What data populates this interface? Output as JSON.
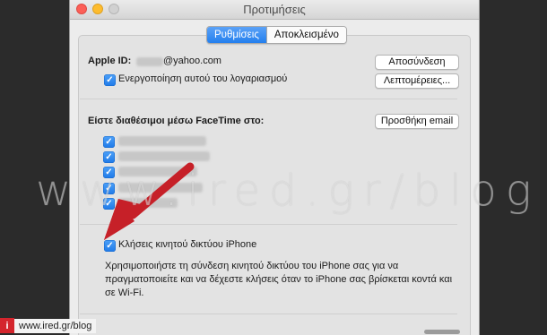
{
  "window": {
    "title": "Προτιμήσεις",
    "tabs": [
      {
        "label": "Ρυθμίσεις",
        "active": true
      },
      {
        "label": "Αποκλεισμένο",
        "active": false
      }
    ]
  },
  "account": {
    "apple_id_label": "Apple ID:",
    "email_suffix": "@yahoo.com",
    "enable_label": "Ενεργοποίηση αυτού του λογαριασμού",
    "enable_checked": true,
    "signout_button": "Αποσύνδεση",
    "details_button": "Λεπτομέρειες..."
  },
  "facetime": {
    "reachable_label": "Είστε διαθέσιμοι μέσω FaceTime στο:",
    "add_email_button": "Προσθήκη email",
    "addresses_checked": [
      true,
      true,
      true,
      true,
      true
    ]
  },
  "cellular": {
    "label": "Κλήσεις κινητού δικτύου iPhone",
    "checked": true,
    "description": "Χρησιμοποιήστε τη σύνδεση κινητού δικτύου του iPhone σας για να πραγματοποιείτε και να δέχεστε κλήσεις όταν το iPhone σας βρίσκεται κοντά και σε Wi-Fi."
  },
  "watermark": "www.ired.gr/blog",
  "footer": {
    "icon_text": "i",
    "text": "www.ired.gr/blog"
  },
  "colors": {
    "accent": "#2a84f0",
    "arrow": "#c62028",
    "brand_red": "#d4252d"
  }
}
